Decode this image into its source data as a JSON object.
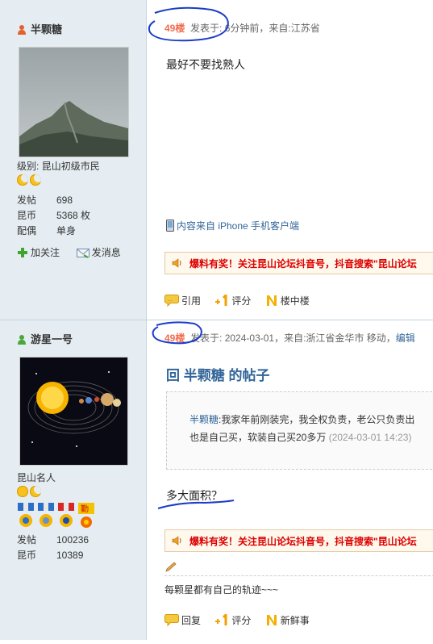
{
  "post1": {
    "username": "半颗糖",
    "level_label": "级别:",
    "level_value": "昆山初级市民",
    "stats": [
      {
        "label": "发帖",
        "value": "698"
      },
      {
        "label": "昆币",
        "value": "5368 枚"
      },
      {
        "label": "配偶",
        "value": "单身"
      }
    ],
    "follow_label": "加关注",
    "message_label": "发消息",
    "floor": "49楼",
    "meta": "发表于: 6分钟前，来自:江苏省",
    "content": "最好不要找熟人",
    "client_note": "内容来自 iPhone 手机客户端",
    "ad_text": "爆料有奖！关注昆山论坛抖音号，抖音搜索\"昆山论坛",
    "actions": [
      "引用",
      "评分",
      "楼中楼"
    ]
  },
  "post2": {
    "username": "游星一号",
    "title_label": "昆山名人",
    "stats": [
      {
        "label": "发帖",
        "value": "100236"
      },
      {
        "label": "昆币",
        "value": "10389"
      }
    ],
    "floor": "49楼",
    "meta_prefix": "发表于: 2024-03-01，来自:浙江省金华市 移动，",
    "meta_edit": "编辑",
    "reply_title": "回 半颗糖 的帖子",
    "quote_user": "半颗糖",
    "quote_text_1": ":我家年前刚装完，我全权负责，老公只负责出",
    "quote_text_2": "也是自己买，软装自己买20多万",
    "quote_time": "(2024-03-01 14:23)",
    "content": "多大面积？",
    "ad_text": "爆料有奖！关注昆山论坛抖音号，抖音搜索\"昆山论坛",
    "signature": "每颗星都有自己的轨迹~~~",
    "actions": [
      "回复",
      "评分",
      "新鲜事"
    ]
  },
  "colors": {
    "sidebar_bg": "#e5edf2",
    "floor": "#f26c4f",
    "link": "#336699",
    "ad_text": "#dd0000"
  }
}
